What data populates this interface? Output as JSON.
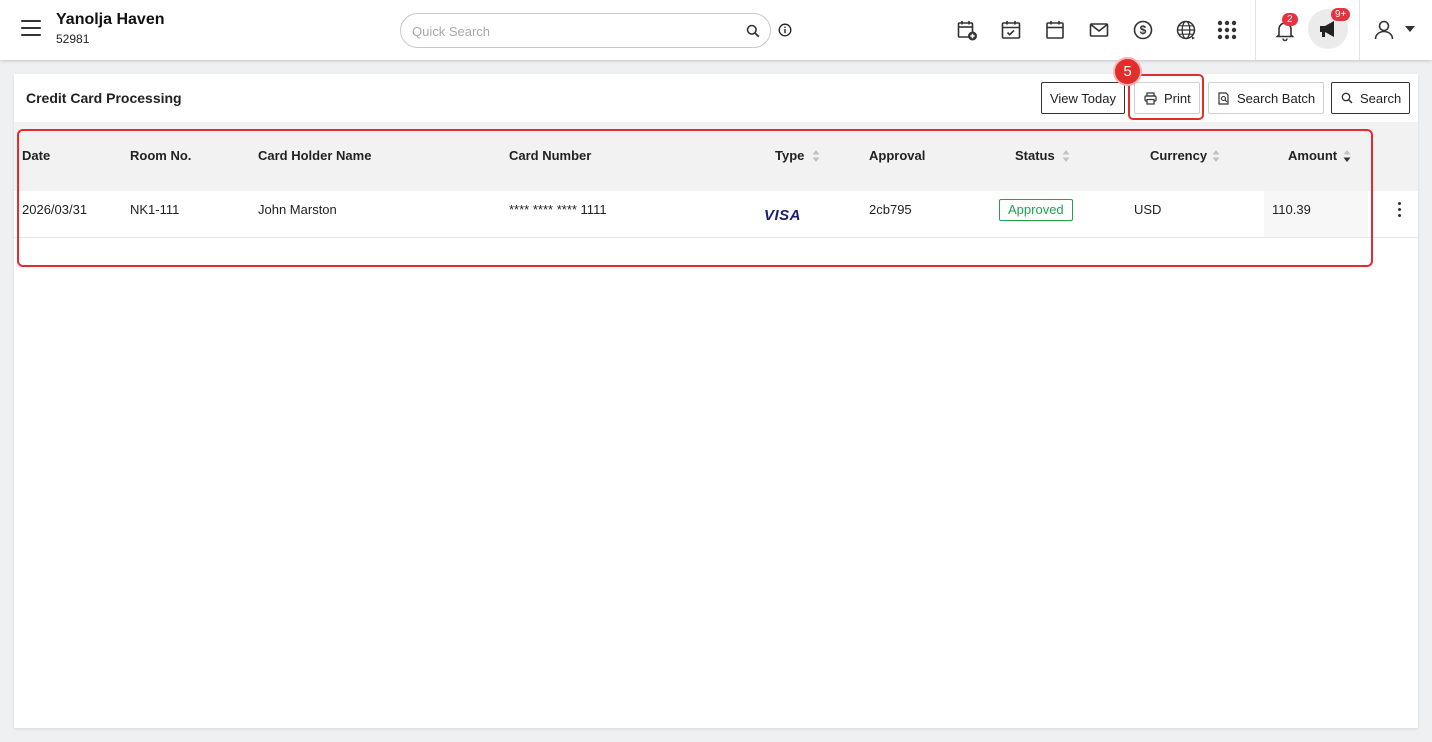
{
  "header": {
    "hotel_name": "Yanolja Haven",
    "hotel_id": "52981",
    "search_placeholder": "Quick Search",
    "notification_count": "2",
    "announcement_count": "9+"
  },
  "page": {
    "title": "Credit Card Processing",
    "buttons": {
      "view_today": "View Today",
      "print": "Print",
      "search_batch": "Search Batch",
      "search": "Search"
    }
  },
  "annotation": {
    "step": "5"
  },
  "table": {
    "columns": {
      "date": "Date",
      "room": "Room No.",
      "holder": "Card Holder Name",
      "card": "Card Number",
      "type": "Type",
      "approval": "Approval",
      "status": "Status",
      "currency": "Currency",
      "amount": "Amount"
    },
    "rows": [
      {
        "date": "2026/03/31",
        "room": "NK1-111",
        "holder": "John Marston",
        "card": "**** **** **** 1111",
        "type": "VISA",
        "approval": "2cb795",
        "status": "Approved",
        "currency": "USD",
        "amount": "110.39"
      }
    ]
  },
  "colors": {
    "accent_red": "#e42c2c",
    "approved_green": "#1fa352",
    "visa_blue": "#1a1f71"
  }
}
